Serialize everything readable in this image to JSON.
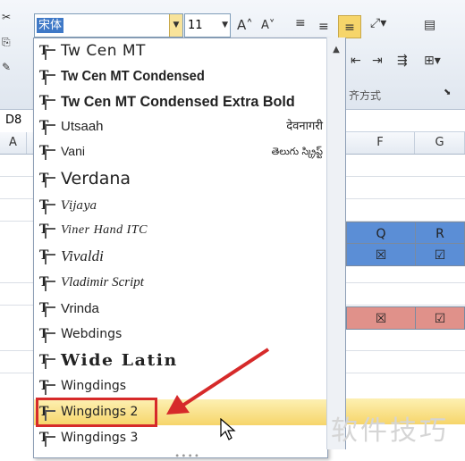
{
  "ribbon": {
    "font_value": "宋体",
    "font_size": "11",
    "grow_font": "A˄",
    "shrink_font": "A˅",
    "alignment_group_label": "齐方式"
  },
  "formula": {
    "name_box": "D8"
  },
  "columns": {
    "a": "A",
    "f": "F",
    "g": "G"
  },
  "cells": {
    "q": "Q",
    "r": "R",
    "box_x": "☒",
    "box_check": "☑"
  },
  "font_list": [
    {
      "name": "Tw Cen MT",
      "sample": ""
    },
    {
      "name": "Tw Cen MT Condensed",
      "sample": ""
    },
    {
      "name": "Tw Cen MT Condensed Extra Bold",
      "sample": ""
    },
    {
      "name": "Utsaah",
      "sample": "देवनागरी"
    },
    {
      "name": "Vani",
      "sample": "తెలుగు స్క్రిప్ట్"
    },
    {
      "name": "Verdana",
      "sample": ""
    },
    {
      "name": "Vijaya",
      "sample": ""
    },
    {
      "name": "Viner Hand ITC",
      "sample": ""
    },
    {
      "name": "Vivaldi",
      "sample": ""
    },
    {
      "name": "Vladimir Script",
      "sample": ""
    },
    {
      "name": "Vrinda",
      "sample": ""
    },
    {
      "name": "Webdings",
      "sample": ""
    },
    {
      "name": "Wide Latin",
      "sample": ""
    },
    {
      "name": "Wingdings",
      "sample": ""
    },
    {
      "name": "Wingdings 2",
      "sample": ""
    },
    {
      "name": "Wingdings 3",
      "sample": ""
    }
  ],
  "watermark": "软件技巧",
  "colors": {
    "highlight": "#f6d56a",
    "annotation_red": "#d62a2a",
    "selection_blue": "#3f79c7"
  }
}
